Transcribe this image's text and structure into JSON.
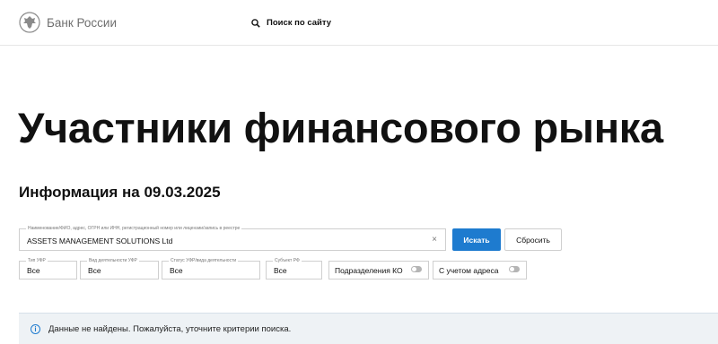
{
  "header": {
    "brand": "Банк России",
    "search_label": "Поиск по сайту"
  },
  "page_title": "Участники финансового рынка",
  "info_date": "Информация на 09.03.2025",
  "search": {
    "label": "Наименование/ФИО, адрес, ОГРН или ИНН, регистрационный номер или лицензии/запись в реестре",
    "value": "ASSETS MANAGEMENT SOLUTIONS Ltd",
    "clear_icon": "×"
  },
  "buttons": {
    "search": "Искать",
    "reset": "Сбросить"
  },
  "filters": [
    {
      "label": "Тип УФР",
      "value": "Все"
    },
    {
      "label": "Вид деятельности УФР",
      "value": "Все"
    },
    {
      "label": "Статус УФР/вида деятельности",
      "value": "Все"
    },
    {
      "label": "Субъект РФ",
      "value": "Все"
    }
  ],
  "toggles": [
    {
      "label": "Подразделения КО",
      "checked": false
    },
    {
      "label": "С учетом адреса",
      "checked": false
    }
  ],
  "alert": {
    "icon": "i",
    "text": "Данные не найдены. Пожалуйста, уточните критерии поиска."
  },
  "colors": {
    "accent": "#1e7bcf",
    "alert_bg": "#eef2f5"
  }
}
